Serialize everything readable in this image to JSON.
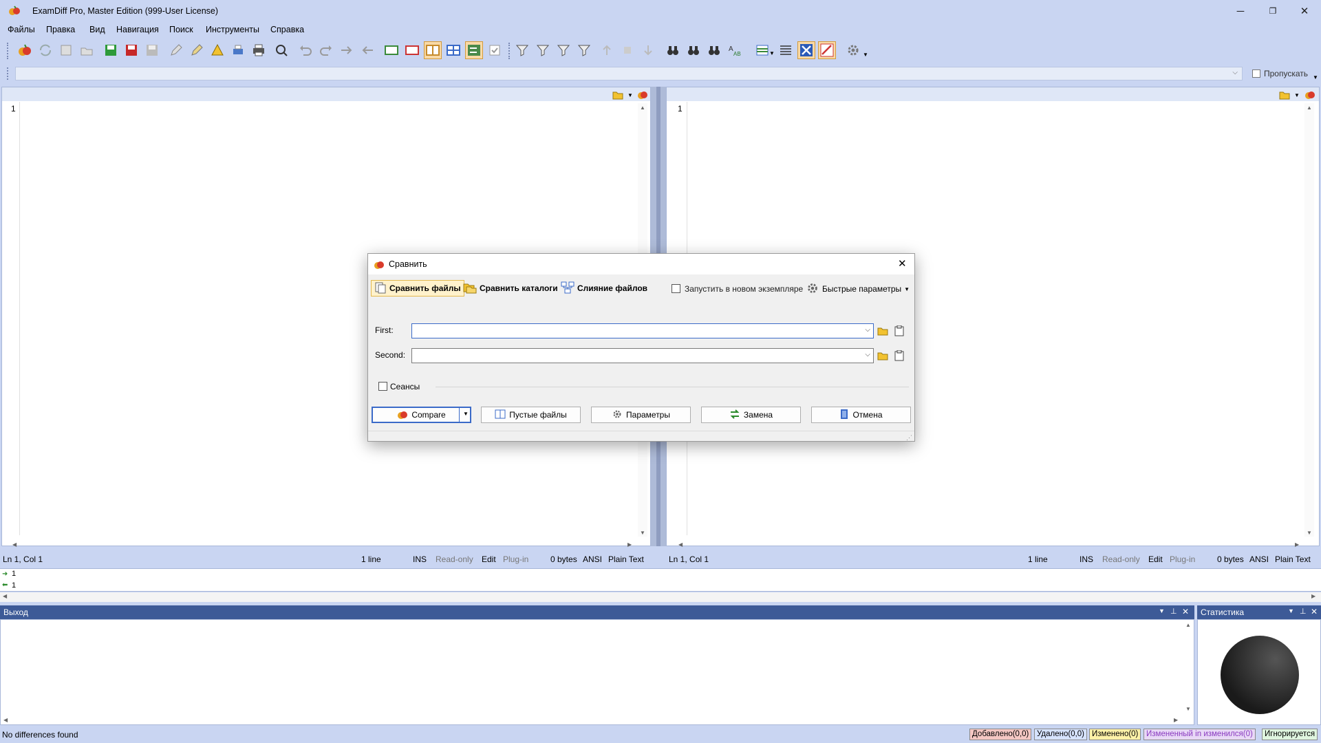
{
  "window": {
    "title": "ExamDiff Pro, Master Edition (999-User License)"
  },
  "menu": [
    "Файлы",
    "Правка",
    "Вид",
    "Навигация",
    "Поиск",
    "Инструменты",
    "Справка"
  ],
  "filterbar": {
    "skip_label": "Пропускать"
  },
  "left_pane": {
    "line_number": "1",
    "status": {
      "position": "Ln 1, Col 1",
      "lines": "1 line",
      "ins": "INS",
      "readonly": "Read-only",
      "edit": "Edit",
      "plugin": "Plug-in",
      "bytes": "0 bytes",
      "encoding": "ANSI",
      "type": "Plain Text"
    }
  },
  "right_pane": {
    "line_number": "1",
    "status": {
      "position": "Ln 1, Col 1",
      "lines": "1 line",
      "ins": "INS",
      "readonly": "Read-only",
      "edit": "Edit",
      "plugin": "Plug-in",
      "bytes": "0 bytes",
      "encoding": "ANSI",
      "type": "Plain Text"
    }
  },
  "diffmap": {
    "line1": "1",
    "line2": "1"
  },
  "output_panel": {
    "title": "Выход"
  },
  "stats_panel": {
    "title": "Статистика"
  },
  "status_bar": {
    "message": "No differences found",
    "added": "Добавлено(0,0)",
    "deleted": "Удалено(0,0)",
    "changed": "Изменено(0)",
    "changed_in_changed": "Измененный in изменился(0)",
    "ignored": "Игнорируется"
  },
  "dialog": {
    "title": "Сравнить",
    "tabs": {
      "compare_files": "Сравнить файлы",
      "compare_dirs": "Сравнить каталоги",
      "merge_files": "Слияние файлов"
    },
    "new_instance_label": "Запустить в новом экземпляре",
    "quick_options_label": "Быстрые параметры",
    "first_label": "First:",
    "second_label": "Second:",
    "first_value": "",
    "second_value": "",
    "sessions_label": "Сеансы",
    "buttons": {
      "compare": "Compare",
      "empty_files": "Пустые файлы",
      "options": "Параметры",
      "swap": "Замена",
      "cancel": "Отмена"
    }
  },
  "colors": {
    "accent": "#3d5a97",
    "chrome": "#c9d5f2",
    "added": "#f4c7c3",
    "deleted": "#d6e3ff",
    "changed": "#fff2a8",
    "changed_in_changed": "#e8d8f6",
    "ignored": "#dff5df"
  }
}
